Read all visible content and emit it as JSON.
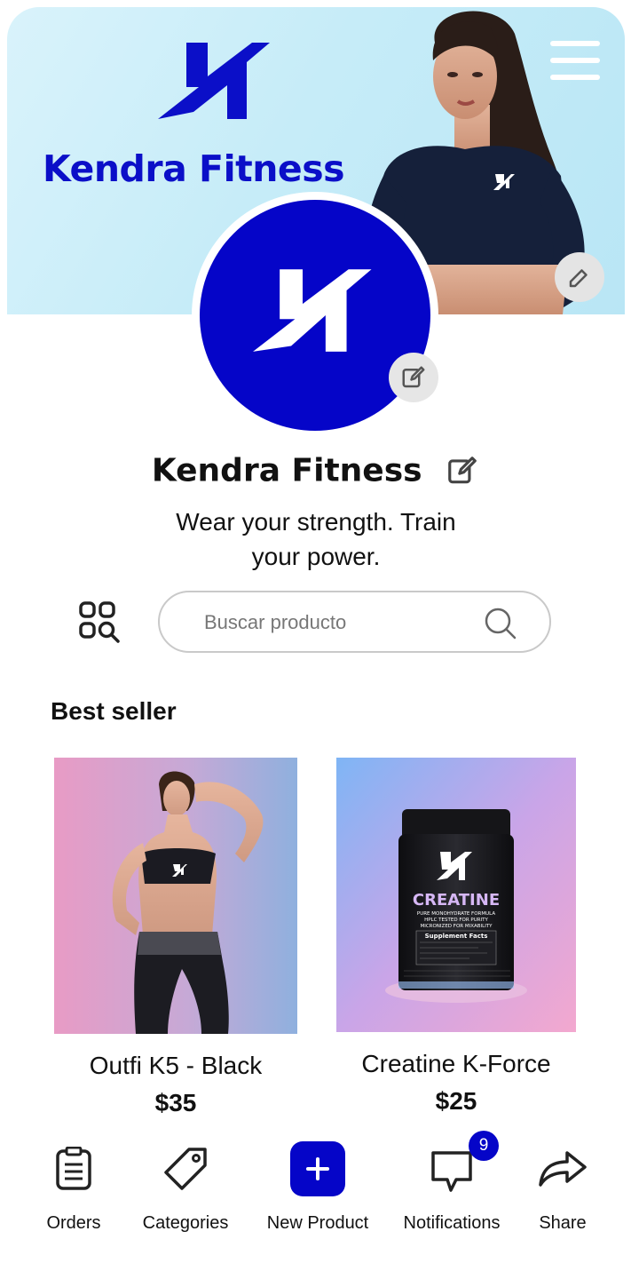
{
  "banner": {
    "brand": "Kendra Fitness",
    "menu_icon": "hamburger-icon",
    "edit_icon": "pencil-icon"
  },
  "profile": {
    "name": "Kendra Fitness",
    "tagline": "Wear your strength. Train your power.",
    "edit_icon": "pencil-icon"
  },
  "search": {
    "placeholder": "Buscar producto",
    "value": "",
    "icon": "search-icon",
    "category_search_icon": "grid-search-icon"
  },
  "best_seller": {
    "title": "Best seller",
    "products": [
      {
        "name": "Outfi K5 - Black",
        "price": "$35"
      },
      {
        "name": "Creatine K-Force",
        "price": "$25"
      }
    ],
    "creatine_label": {
      "title": "CREATINE",
      "line1": "PURE MONOHYDRATE FORMULA",
      "line2": "HPLC TESTED FOR PURITY",
      "line3": "MICRONIZED FOR MIXABILITY",
      "facts": "Supplement Facts"
    }
  },
  "bottom_nav": {
    "items": [
      {
        "label": "Orders",
        "icon": "clipboard-icon"
      },
      {
        "label": "Categories",
        "icon": "tag-icon"
      },
      {
        "label": "New Product",
        "icon": "plus-icon"
      },
      {
        "label": "Notifications",
        "icon": "chat-bubble-icon",
        "badge": "9"
      },
      {
        "label": "Share",
        "icon": "share-arrow-icon"
      }
    ]
  },
  "colors": {
    "brand_blue": "#0505c8",
    "banner_bg": "#c6ecf8",
    "text": "#111111"
  }
}
